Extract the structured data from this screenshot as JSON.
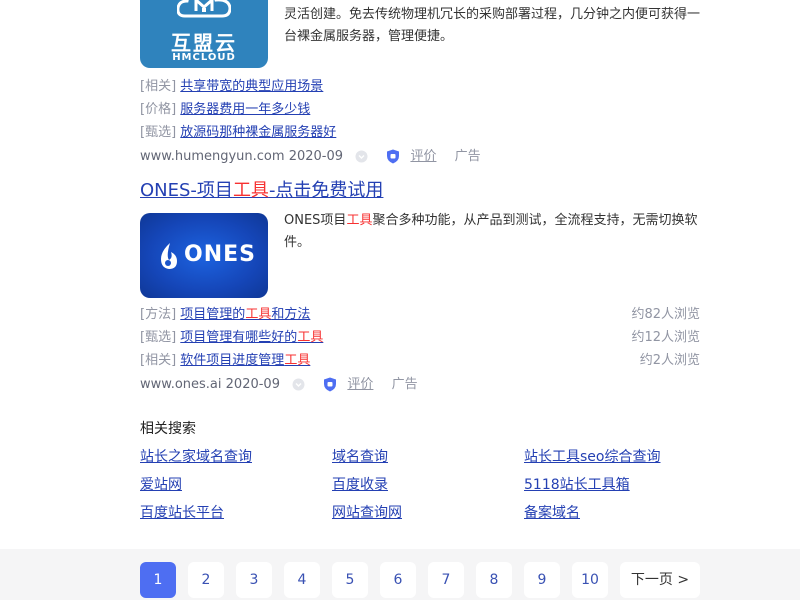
{
  "result1": {
    "logo_cn": "互盟云",
    "logo_en": "HMCLOUD",
    "desc_line1": "灵活创建。免去传统物理机冗长的采购部署过程，几分钟之内便可获得一",
    "desc_line2": "台裸金属服务器，管理便捷。",
    "sublinks": [
      {
        "tag": "[相关]",
        "text": "共享带宽的典型应用场景"
      },
      {
        "tag": "[价格]",
        "text": "服务器费用一年多少钱"
      },
      {
        "tag": "[甄选]",
        "text": "放源码那种裸金属服务器好"
      }
    ],
    "source_url": "www.humengyun.com",
    "source_date": "2020-09",
    "review": "评价",
    "ad": "广告"
  },
  "result2": {
    "title_pre": "ONES-项目",
    "title_hl": "工具",
    "title_post": "-点击免费试用",
    "logo_word": "ONES",
    "desc_pre": "ONES项目",
    "desc_hl": "工具",
    "desc_post1": "聚合多种功能，从产品到测试，全流程支持，无需切换软",
    "desc_line2": "件。",
    "sublinks": [
      {
        "tag": "[方法]",
        "pre": "项目管理的",
        "hl": "工具",
        "post": "和方法",
        "views": "约82人浏览"
      },
      {
        "tag": "[甄选]",
        "pre": "项目管理有哪些好的",
        "hl": "工具",
        "post": "",
        "views": "约12人浏览"
      },
      {
        "tag": "[相关]",
        "pre": "软件项目进度管理",
        "hl": "工具",
        "post": "",
        "views": "约2人浏览"
      }
    ],
    "source_url": "www.ones.ai",
    "source_date": "2020-09",
    "review": "评价",
    "ad": "广告"
  },
  "related": {
    "title": "相关搜索",
    "items": [
      "站长之家域名查询",
      "域名查询",
      "站长工具seo综合查询",
      "爱站网",
      "百度收录",
      "5118站长工具箱",
      "百度站长平台",
      "网站查询网",
      "备案域名"
    ]
  },
  "pagination": {
    "pages": [
      "1",
      "2",
      "3",
      "4",
      "5",
      "6",
      "7",
      "8",
      "9",
      "10"
    ],
    "next": "下一页 >"
  },
  "colors": {
    "link": "#2440b3",
    "highlight": "#f73131",
    "active_page": "#4e6ef2"
  }
}
